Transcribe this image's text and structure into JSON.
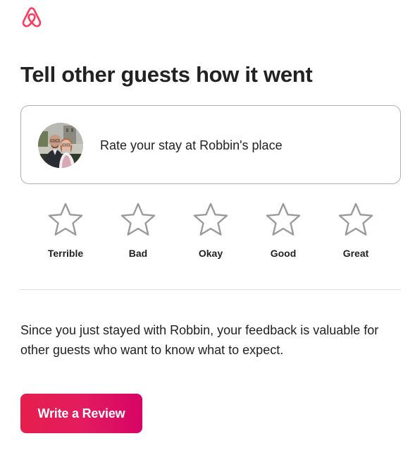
{
  "brand": {
    "logo_icon": "airbnb-logo-icon",
    "accent_color": "#FF385C"
  },
  "page_title": "Tell other guests how it went",
  "host_card": {
    "avatar_icon": "host-avatar",
    "text": "Rate your stay at Robbin's place"
  },
  "ratings": [
    {
      "label": "Terrible",
      "icon": "star-outline-icon"
    },
    {
      "label": "Bad",
      "icon": "star-outline-icon"
    },
    {
      "label": "Okay",
      "icon": "star-outline-icon"
    },
    {
      "label": "Good",
      "icon": "star-outline-icon"
    },
    {
      "label": "Great",
      "icon": "star-outline-icon"
    }
  ],
  "feedback_text": "Since you just stayed with Robbin, your feedback is valuable for other guests who want to know what to expect.",
  "cta": {
    "label": "Write a Review",
    "gradient_start": "#E61E4D",
    "gradient_end": "#D70466"
  }
}
